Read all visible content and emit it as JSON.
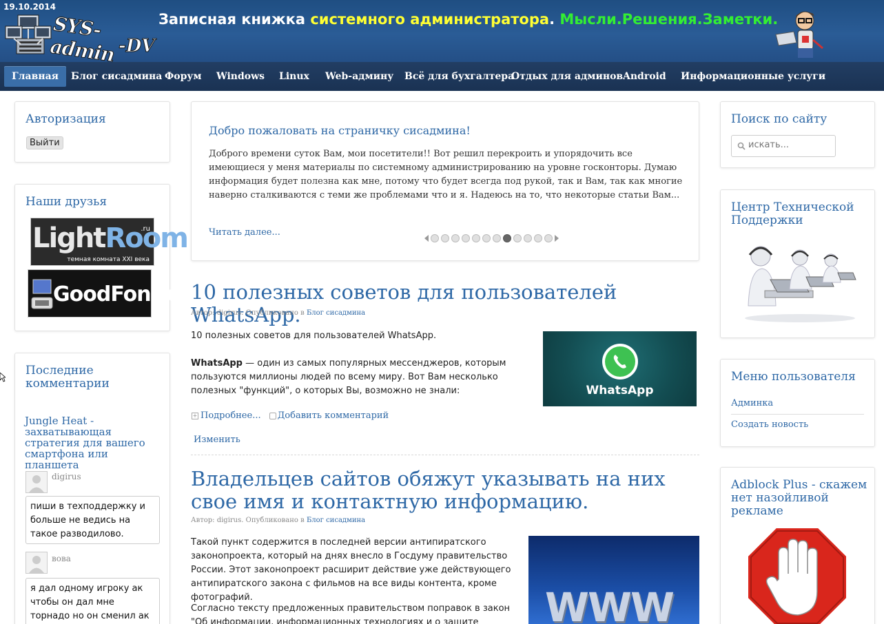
{
  "header": {
    "date": "19.10.2014",
    "logo_line1": "SYS-admin",
    "logo_line2": "-DV",
    "slogan_part1": "Записная книжка ",
    "slogan_part2": "системного администратора",
    "slogan_part3": ". ",
    "slogan_part4": "Мысли.Решения.Заметки."
  },
  "nav": {
    "items": [
      {
        "label": "Главная",
        "active": true
      },
      {
        "label": "Блог сисадмина"
      },
      {
        "label": "Форум"
      },
      {
        "label": "Windows"
      },
      {
        "label": "Linux"
      },
      {
        "label": "Web-админу"
      },
      {
        "label": "Всё для бухгалтера"
      },
      {
        "label": "Отдых для админов"
      },
      {
        "label": "Android"
      },
      {
        "label": "Информационные услуги"
      }
    ]
  },
  "left": {
    "auth": {
      "title": "Авторизация",
      "logout_label": "Выйти"
    },
    "friends": {
      "title": "Наши друзья",
      "lightroom_main_a": "Light",
      "lightroom_main_b": "Room",
      "lightroom_ru": ".ru",
      "lightroom_sub": "темная комната XXI века",
      "goodfon": "GoodFon.ru"
    },
    "comments": {
      "title": "Последние комментарии",
      "post_title": "Jungle Heat - захватывающая стратегия для вашего смартфона или планшета",
      "items": [
        {
          "author": "digirus",
          "text": "пиши в техподдержку и больше не ведись на такое разводилово."
        },
        {
          "author": "вова",
          "text": "я дал одному игроку ак чтобы он дал мне торнадо но он сменил ак дал мне ак"
        }
      ]
    }
  },
  "welcome": {
    "title": "Добро пожаловать на страничку сисадмина!",
    "text": "Доброго времени суток Вам, мои посетители!! Вот решил перекроить и упорядочить все имеющиеся у меня материалы по системному администрированию на уровне госконторы. Думаю информация будет полезна как мне, потому что будет всегда под рукой, так и Вам, так как многие наверно сталкиваются с теми же проблемами что и я. Надеюсь на то, что некоторые статьи Вам...",
    "more": "Читать далее...",
    "slider_total": 12,
    "slider_active": 8
  },
  "articles": [
    {
      "title": "10 полезных советов для пользователей WhatsApp.",
      "meta_prefix": "Автор: digirus. Опубликовано в ",
      "category": "Блог сисадмина",
      "lead": "10 полезных советов для пользователей WhatsApp.",
      "bold": "WhatsApp",
      "body": " — один из самых популярных мессенджеров, которым пользуются миллионы людей по всему миру. Вот Вам несколько полезных \"функций\", о которых Вы, возможно не знали:",
      "image_label": "WhatsApp",
      "more": "Подробнее...",
      "add_comment": "Добавить комментарий",
      "edit": "Изменить"
    },
    {
      "title": "Владельцев сайтов обяжут указывать на них свое имя и контактную информацию.",
      "meta_prefix": "Автор: digirus. Опубликовано в ",
      "category": "Блог сисадмина",
      "p1": "Такой пункт содержится в последней версии антипиратского законопроекта, который на днях внесло в Госдуму правительство России. Этот законопроект расширит действие уже действующего антипиратского закона с фильмов на все виды контента, кроме фотографий.",
      "p2": "Согласно тексту предложенных правительством поправок в закон \"Об информации, информационных технологиях и о защите информации\"",
      "image_label": "WWW"
    }
  ],
  "right": {
    "search": {
      "title": "Поиск по сайту",
      "placeholder": "искать..."
    },
    "support": {
      "title": "Центр Технической Поддержки"
    },
    "user_menu": {
      "title": "Меню пользователя",
      "items": [
        "Админка",
        "Создать новость"
      ]
    },
    "adblock": {
      "title": "Adblock Plus - скажем нет назойливой рекламе"
    }
  },
  "colors": {
    "link": "#2e68a6",
    "header_bg": "#24528a",
    "nav_bg": "#1d3759",
    "nav_active": "#3a6ea8",
    "slogan_yellow": "#ffff33",
    "slogan_green": "#33ee33",
    "adblock_red": "#d9261c"
  }
}
